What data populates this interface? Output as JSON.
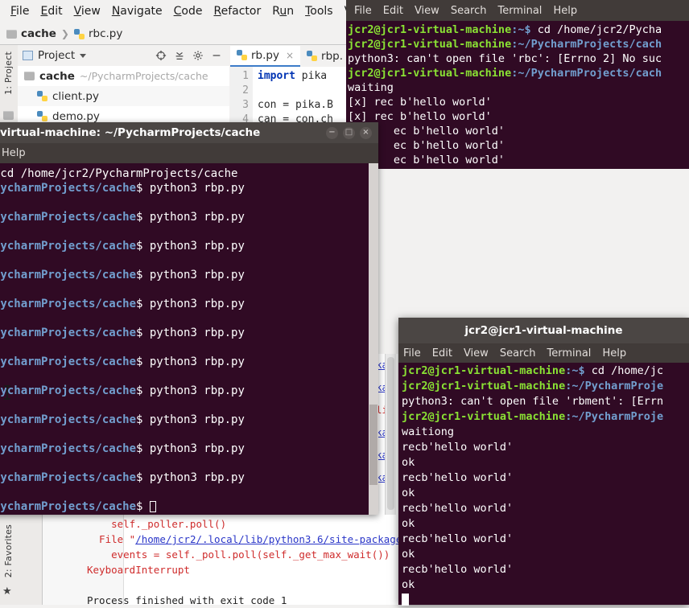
{
  "ide": {
    "menubar": [
      "File",
      "Edit",
      "View",
      "Navigate",
      "Code",
      "Refactor",
      "Run",
      "Tools",
      "VCS"
    ],
    "breadcrumb": {
      "project": "cache",
      "file": "rbc.py"
    },
    "left_strip": {
      "project_label": "1: Project",
      "favorites_label": "2: Favorites"
    },
    "project_panel": {
      "title": "Project",
      "root": "cache",
      "root_path": "~/PycharmProjects/cache",
      "files": [
        "client.py",
        "demo.py"
      ]
    },
    "editor": {
      "tabs": [
        {
          "label": "rb.py",
          "close": "×"
        },
        {
          "label": "rbp.",
          "close": ""
        }
      ],
      "line_numbers": [
        "1",
        "2",
        "3",
        "4"
      ],
      "code": [
        {
          "kw": "import",
          "rest": " pika"
        },
        {
          "kw": "",
          "rest": ""
        },
        {
          "kw": "",
          "rest": "con = pika.B"
        },
        {
          "kw": "",
          "rest": "can = con.ch"
        }
      ]
    },
    "console": {
      "lines": [
        {
          "text": "    self._poller.poll()",
          "link": ""
        },
        {
          "pre": "  File \"",
          "link": "/home/jcr2/.local/lib/python3.6/site-packages/pika",
          "post": ""
        },
        {
          "text": "    events = self._poll.poll(self._get_max_wait())",
          "link": ""
        },
        {
          "text": "KeyboardInterrupt",
          "link": ""
        },
        {
          "text": "",
          "link": ""
        },
        {
          "text": "Process finished with exit code 1",
          "link": "",
          "plain": true
        }
      ],
      "mid_fragments": [
        "ika,",
        "ika,",
        " li",
        "ika,",
        "ika,",
        "ika,"
      ]
    }
  },
  "terminal_top": {
    "menu": [
      "File",
      "Edit",
      "View",
      "Search",
      "Terminal",
      "Help"
    ],
    "lines": [
      {
        "user": "jcr2@jcr1-virtual-machine",
        "path": ":~$ ",
        "text": "cd /home/jcr2/Pycha"
      },
      {
        "user": "jcr2@jcr1-virtual-machine",
        "path": ":~/PycharmProjects/cach",
        "text": ""
      },
      {
        "user": "",
        "path": "",
        "text": "python3: can't open file 'rbc': [Errno 2] No suc"
      },
      {
        "user": "jcr2@jcr1-virtual-machine",
        "path": ":~/PycharmProjects/cach",
        "text": ""
      },
      {
        "user": "",
        "path": "",
        "text": "waiting"
      },
      {
        "user": "",
        "path": "",
        "text": "[x] rec b'hello world'"
      },
      {
        "user": "",
        "path": "",
        "text": "[x] rec b'hello world'"
      },
      {
        "user": "",
        "path": "",
        "text": "       ec b'hello world'"
      },
      {
        "user": "",
        "path": "",
        "text": "       ec b'hello world'"
      },
      {
        "user": "",
        "path": "",
        "text": "       ec b'hello world'"
      }
    ]
  },
  "terminal_mid": {
    "title": "virtual-machine: ~/PycharmProjects/cache",
    "window_buttons": [
      "−",
      "□",
      "×"
    ],
    "menu": [
      "Help"
    ],
    "lines": [
      {
        "path": "",
        "cmd": " cd /home/jcr2/PycharmProjects/cache"
      },
      {
        "path": "PycharmProjects/cache",
        "cmd": "$ python3 rbp.py"
      },
      {
        "path": "",
        "cmd": ""
      },
      {
        "path": "PycharmProjects/cache",
        "cmd": "$ python3 rbp.py"
      },
      {
        "path": "",
        "cmd": ""
      },
      {
        "path": "PycharmProjects/cache",
        "cmd": "$ python3 rbp.py"
      },
      {
        "path": "",
        "cmd": ""
      },
      {
        "path": "PycharmProjects/cache",
        "cmd": "$ python3 rbp.py"
      },
      {
        "path": "",
        "cmd": ""
      },
      {
        "path": "PycharmProjects/cache",
        "cmd": "$ python3 rbp.py"
      },
      {
        "path": "",
        "cmd": ""
      },
      {
        "path": "PycharmProjects/cache",
        "cmd": "$ python3 rbp.py"
      },
      {
        "path": "",
        "cmd": ""
      },
      {
        "path": "PycharmProjects/cache",
        "cmd": "$ python3 rbp.py"
      },
      {
        "path": "",
        "cmd": ""
      },
      {
        "path": "PycharmProjects/cache",
        "cmd": "$ python3 rbp.py"
      },
      {
        "path": "",
        "cmd": ""
      },
      {
        "path": "PycharmProjects/cache",
        "cmd": "$ python3 rbp.py"
      },
      {
        "path": "",
        "cmd": ""
      },
      {
        "path": "PycharmProjects/cache",
        "cmd": "$ python3 rbp.py"
      },
      {
        "path": "",
        "cmd": ""
      },
      {
        "path": "PycharmProjects/cache",
        "cmd": "$ python3 rbp.py"
      },
      {
        "path": "",
        "cmd": ""
      },
      {
        "path": "PycharmProjects/cache",
        "cmd": "$ ",
        "cursor": "hollow"
      }
    ]
  },
  "terminal_bottom": {
    "title": "jcr2@jcr1-virtual-machine",
    "menu": [
      "File",
      "Edit",
      "View",
      "Search",
      "Terminal",
      "Help"
    ],
    "lines": [
      {
        "user": "jcr2@jcr1-virtual-machine",
        "path": ":~$ ",
        "text": "cd /home/jc"
      },
      {
        "user": "jcr2@jcr1-virtual-machine",
        "path": ":~/PycharmProje",
        "text": ""
      },
      {
        "user": "",
        "path": "",
        "text": "python3: can't open file 'rbment': [Errn"
      },
      {
        "user": "jcr2@jcr1-virtual-machine",
        "path": ":~/PycharmProje",
        "text": ""
      },
      {
        "user": "",
        "path": "",
        "text": "waitiong"
      },
      {
        "user": "",
        "path": "",
        "text": "recb'hello world'"
      },
      {
        "user": "",
        "path": "",
        "text": "ok"
      },
      {
        "user": "",
        "path": "",
        "text": "recb'hello world'"
      },
      {
        "user": "",
        "path": "",
        "text": "ok"
      },
      {
        "user": "",
        "path": "",
        "text": "recb'hello world'"
      },
      {
        "user": "",
        "path": "",
        "text": "ok"
      },
      {
        "user": "",
        "path": "",
        "text": "recb'hello world'"
      },
      {
        "user": "",
        "path": "",
        "text": "ok"
      },
      {
        "user": "",
        "path": "",
        "text": "recb'hello world'"
      },
      {
        "user": "",
        "path": "",
        "text": "ok"
      },
      {
        "user": "",
        "path": "",
        "text": "",
        "cursor": "block"
      }
    ]
  },
  "colors": {
    "terminal_bg": "#300a24",
    "terminal_chrome": "#413b39",
    "titlebar": "#4b4644",
    "prompt_user": "#8ae234",
    "prompt_path": "#729fcf",
    "ide_bg": "#f2f1f0",
    "error_text": "#cf2c2c",
    "link": "#2a36c8"
  }
}
